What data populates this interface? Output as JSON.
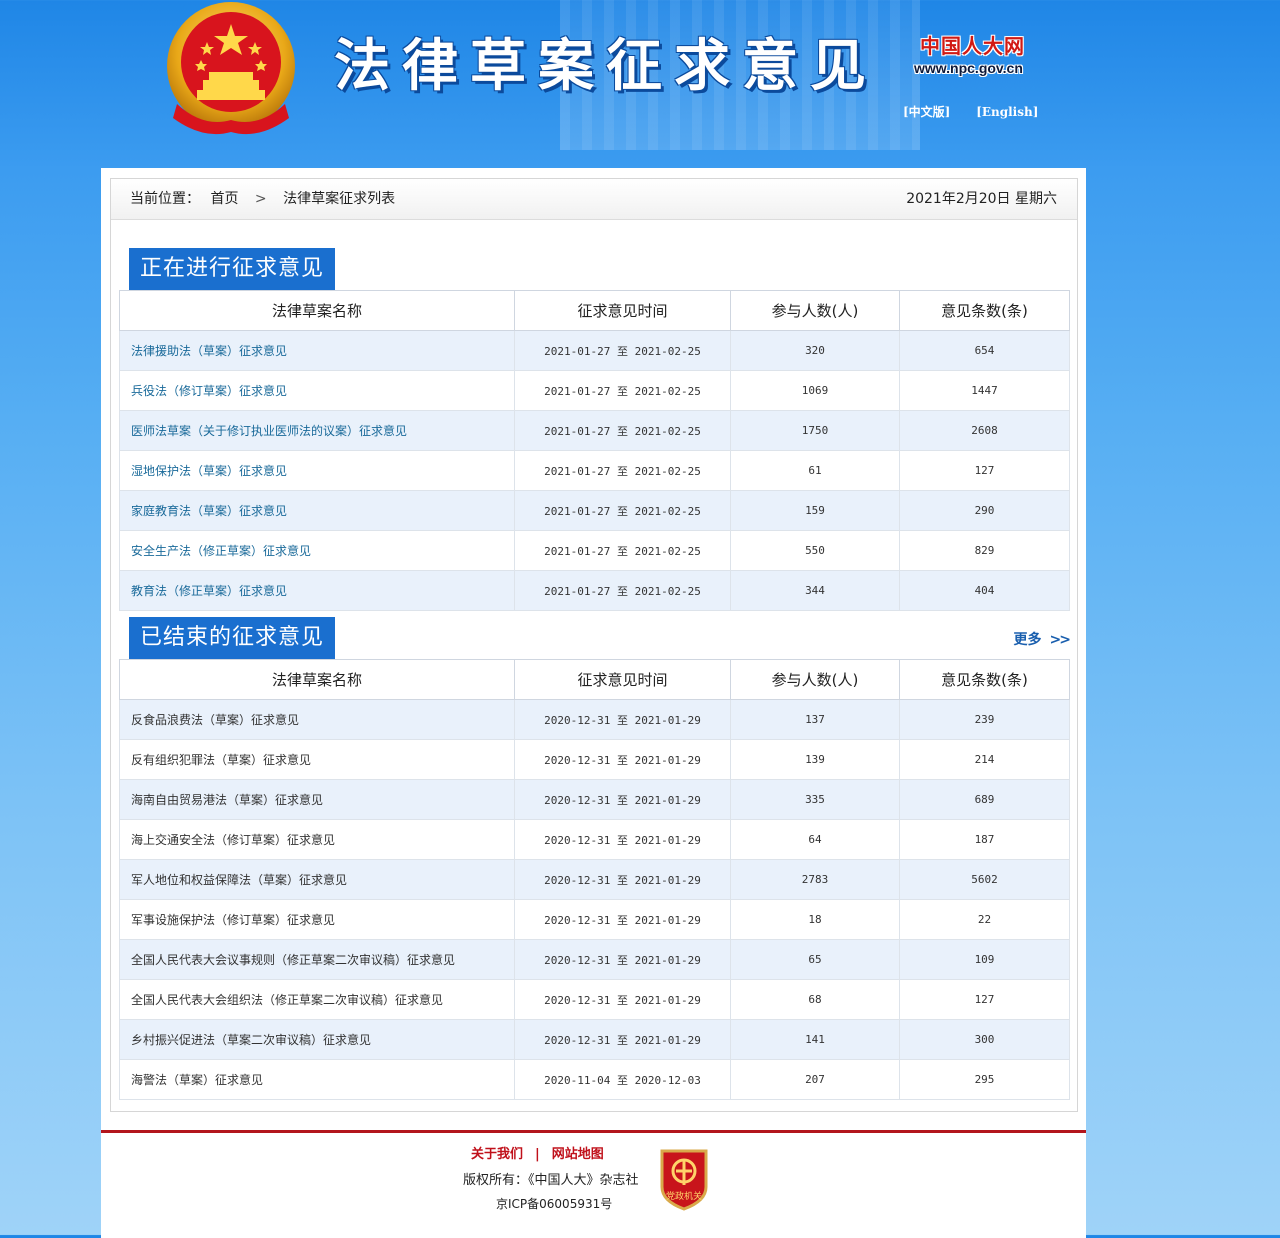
{
  "header": {
    "site_title": "法律草案征求意见",
    "npc_logo_text": "中国人大网",
    "npc_url": "www.npc.gov.cn",
    "lang_links": [
      "[中文版]",
      "[English]"
    ],
    "emblem_icon": "national-emblem-icon"
  },
  "breadcrumb": {
    "prefix": "当前位置：",
    "home": "首页",
    "separator": ">",
    "current": "法律草案征求列表",
    "date": "2021年2月20日  星期六"
  },
  "active_section": {
    "title": "正在进行征求意见",
    "columns": [
      "法律草案名称",
      "征求意见时间",
      "参与人数(人)",
      "意见条数(条)"
    ],
    "rows": [
      {
        "name": "法律援助法（草案）征求意见",
        "period": "2021-01-27 至 2021-02-25",
        "participants": "320",
        "opinions": "654"
      },
      {
        "name": "兵役法（修订草案）征求意见",
        "period": "2021-01-27 至 2021-02-25",
        "participants": "1069",
        "opinions": "1447"
      },
      {
        "name": "医师法草案（关于修订执业医师法的议案）征求意见",
        "period": "2021-01-27 至 2021-02-25",
        "participants": "1750",
        "opinions": "2608"
      },
      {
        "name": "湿地保护法（草案）征求意见",
        "period": "2021-01-27 至 2021-02-25",
        "participants": "61",
        "opinions": "127"
      },
      {
        "name": "家庭教育法（草案）征求意见",
        "period": "2021-01-27 至 2021-02-25",
        "participants": "159",
        "opinions": "290"
      },
      {
        "name": "安全生产法（修正草案）征求意见",
        "period": "2021-01-27 至 2021-02-25",
        "participants": "550",
        "opinions": "829"
      },
      {
        "name": "教育法（修正草案）征求意见",
        "period": "2021-01-27 至 2021-02-25",
        "participants": "344",
        "opinions": "404"
      }
    ]
  },
  "closed_section": {
    "title": "已结束的征求意见",
    "more_label": "更多",
    "more_icon": "double-chevron-right-icon",
    "columns": [
      "法律草案名称",
      "征求意见时间",
      "参与人数(人)",
      "意见条数(条)"
    ],
    "rows": [
      {
        "name": "反食品浪费法（草案）征求意见",
        "period": "2020-12-31 至 2021-01-29",
        "participants": "137",
        "opinions": "239"
      },
      {
        "name": "反有组织犯罪法（草案）征求意见",
        "period": "2020-12-31 至 2021-01-29",
        "participants": "139",
        "opinions": "214"
      },
      {
        "name": "海南自由贸易港法（草案）征求意见",
        "period": "2020-12-31 至 2021-01-29",
        "participants": "335",
        "opinions": "689"
      },
      {
        "name": "海上交通安全法（修订草案）征求意见",
        "period": "2020-12-31 至 2021-01-29",
        "participants": "64",
        "opinions": "187"
      },
      {
        "name": "军人地位和权益保障法（草案）征求意见",
        "period": "2020-12-31 至 2021-01-29",
        "participants": "2783",
        "opinions": "5602"
      },
      {
        "name": "军事设施保护法（修订草案）征求意见",
        "period": "2020-12-31 至 2021-01-29",
        "participants": "18",
        "opinions": "22"
      },
      {
        "name": "全国人民代表大会议事规则（修正草案二次审议稿）征求意见",
        "period": "2020-12-31 至 2021-01-29",
        "participants": "65",
        "opinions": "109"
      },
      {
        "name": "全国人民代表大会组织法（修正草案二次审议稿）征求意见",
        "period": "2020-12-31 至 2021-01-29",
        "participants": "68",
        "opinions": "127"
      },
      {
        "name": "乡村振兴促进法（草案二次审议稿）征求意见",
        "period": "2020-12-31 至 2021-01-29",
        "participants": "141",
        "opinions": "300"
      },
      {
        "name": "海警法（草案）征求意见",
        "period": "2020-11-04 至 2020-12-03",
        "participants": "207",
        "opinions": "295"
      }
    ]
  },
  "footer": {
    "about_label": "关于我们",
    "divider": "|",
    "sitemap_label": "网站地图",
    "copyright": "版权所有：《中国人大》杂志社",
    "icp": "京ICP备06005931号",
    "badge_icon": "party-government-organ-badge-icon",
    "badge_text": "党政机关"
  },
  "colors": {
    "header_blue": "#1f86e6",
    "section_title_bg": "#1a6fcf",
    "row_alt_bg": "#e9f1fb",
    "footer_red": "#b3161c",
    "link_blue": "#1a6a9a"
  }
}
